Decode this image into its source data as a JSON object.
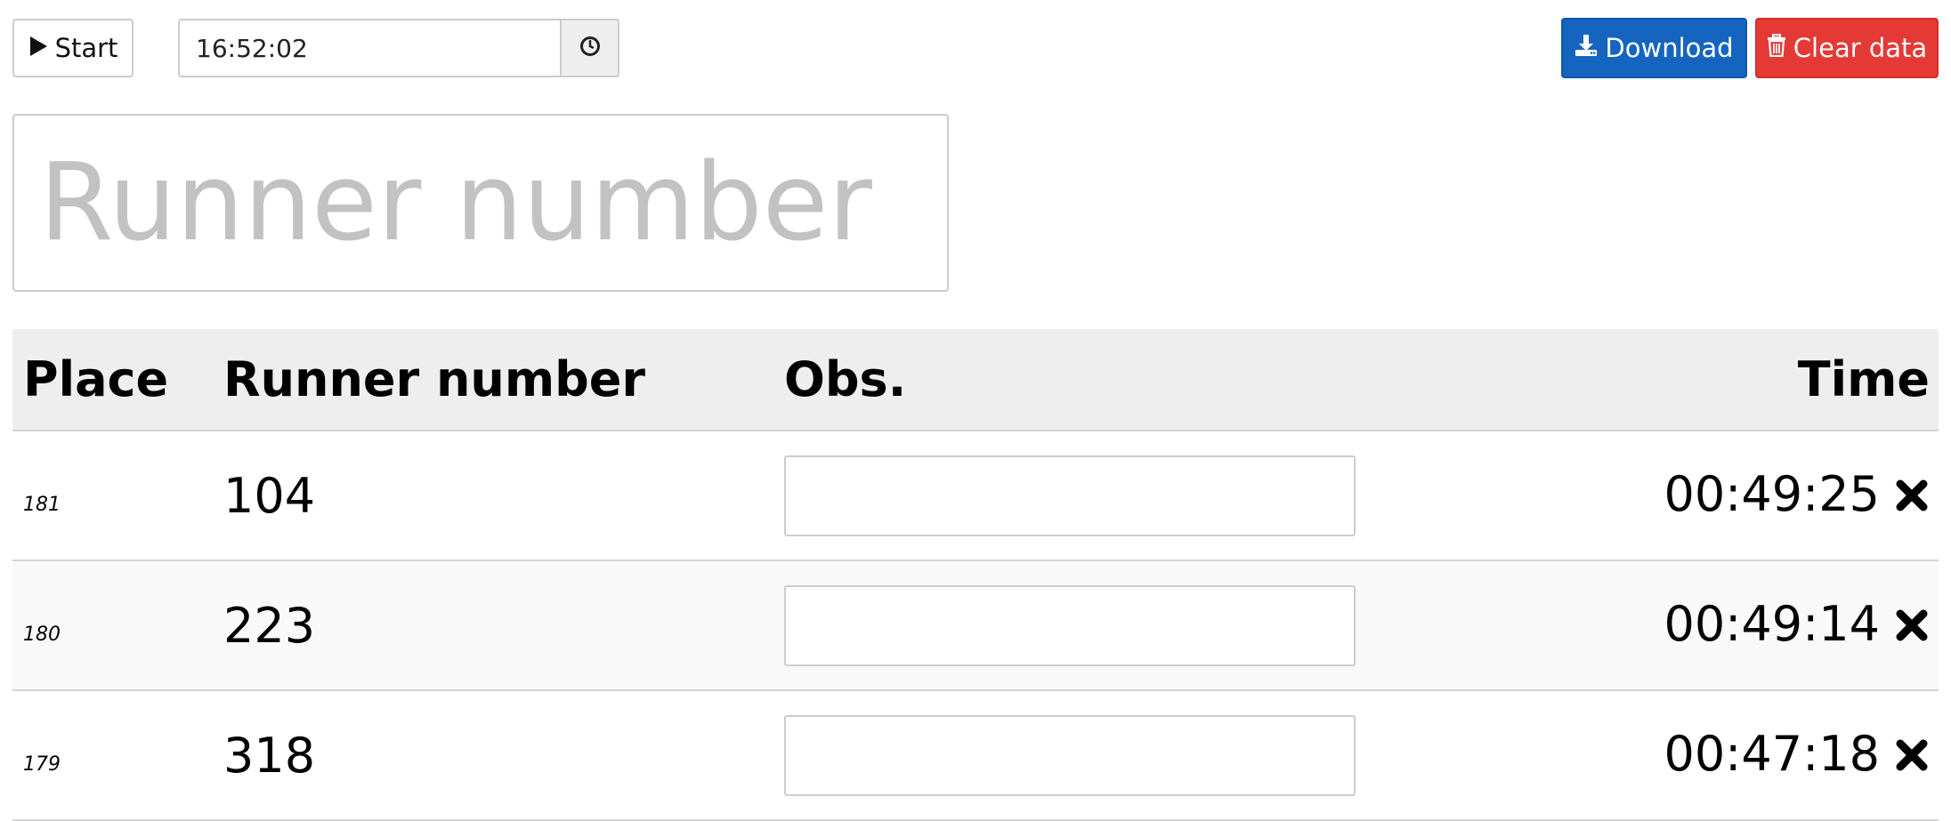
{
  "toolbar": {
    "start_label": "Start",
    "time_value": "16:52:02",
    "download_label": "Download",
    "clear_label": "Clear data",
    "download_color": "#1565c0",
    "clear_color": "#e53935"
  },
  "runner_input": {
    "placeholder": "Runner number",
    "value": ""
  },
  "table": {
    "headers": {
      "place": "Place",
      "runner_number": "Runner number",
      "obs": "Obs.",
      "time": "Time"
    },
    "rows": [
      {
        "place": "181",
        "runner_number": "104",
        "obs": "",
        "time": "00:49:25"
      },
      {
        "place": "180",
        "runner_number": "223",
        "obs": "",
        "time": "00:49:14"
      },
      {
        "place": "179",
        "runner_number": "318",
        "obs": "",
        "time": "00:47:18"
      }
    ]
  },
  "icons": {
    "start": "play-icon",
    "time_addon": "clock-icon",
    "download": "download-icon",
    "clear": "trash-icon",
    "delete_row": "close-icon"
  }
}
